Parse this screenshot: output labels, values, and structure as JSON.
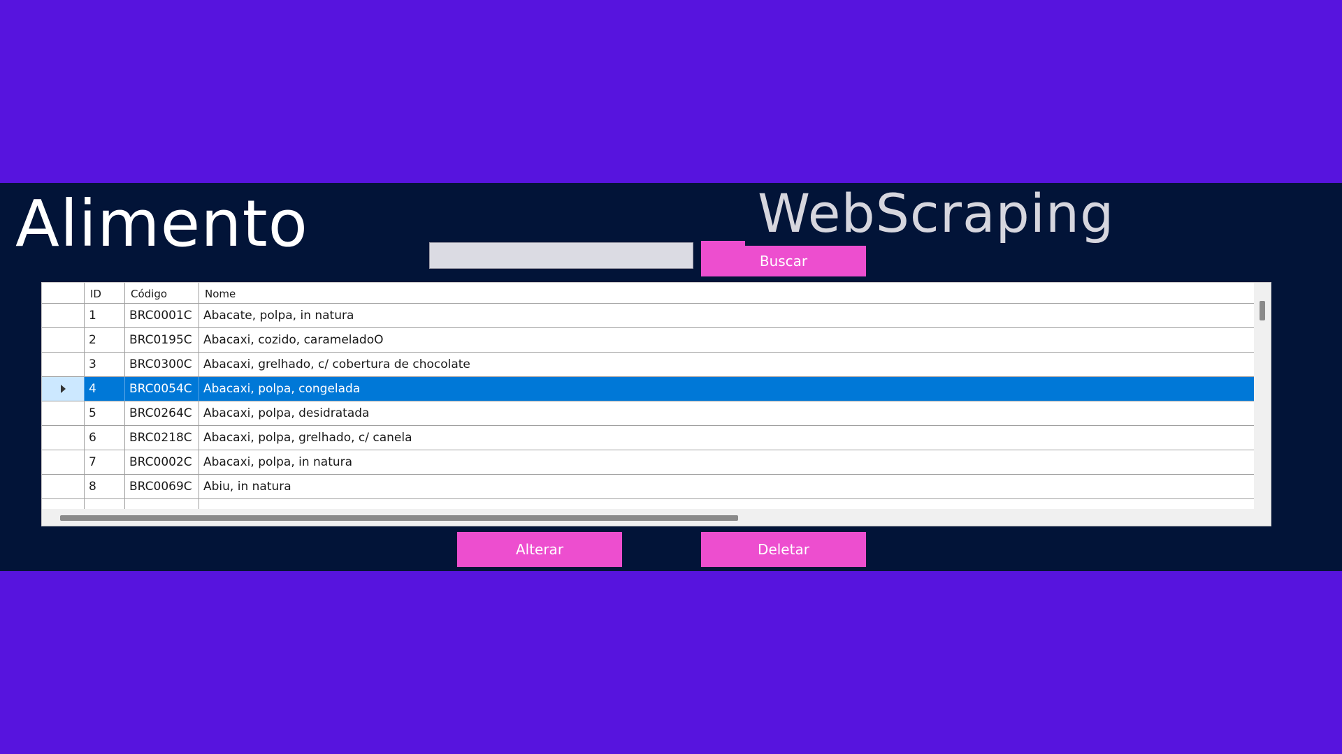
{
  "header": {
    "title_left": "Alimento",
    "title_right": "WebScraping"
  },
  "search": {
    "value": "",
    "placeholder": "",
    "button_label": "Buscar"
  },
  "grid": {
    "columns": [
      "ID",
      "Código",
      "Nome"
    ],
    "rows": [
      {
        "id": "1",
        "codigo": "BRC0001C",
        "nome": "Abacate, polpa, in natura"
      },
      {
        "id": "2",
        "codigo": "BRC0195C",
        "nome": "Abacaxi, cozido, carameladoO"
      },
      {
        "id": "3",
        "codigo": "BRC0300C",
        "nome": "Abacaxi, grelhado, c/ cobertura de chocolate"
      },
      {
        "id": "4",
        "codigo": "BRC0054C",
        "nome": "Abacaxi, polpa, congelada"
      },
      {
        "id": "5",
        "codigo": "BRC0264C",
        "nome": "Abacaxi, polpa, desidratada"
      },
      {
        "id": "6",
        "codigo": "BRC0218C",
        "nome": "Abacaxi, polpa, grelhado, c/ canela"
      },
      {
        "id": "7",
        "codigo": "BRC0002C",
        "nome": "Abacaxi, polpa, in natura"
      },
      {
        "id": "8",
        "codigo": "BRC0069C",
        "nome": "Abiu, in natura"
      }
    ],
    "selected_row_index": 3
  },
  "actions": {
    "alterar_label": "Alterar",
    "deletar_label": "Deletar"
  },
  "colors": {
    "background": "#5714DE",
    "panel": "#021438",
    "button": "#ED4ECF",
    "selection": "#0078D7"
  }
}
